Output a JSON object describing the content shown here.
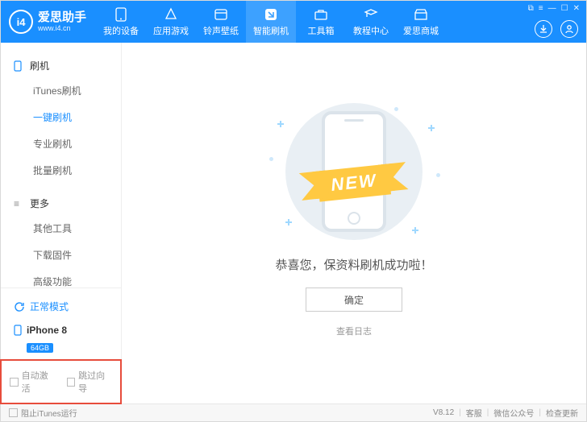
{
  "app": {
    "name": "爱思助手",
    "domain": "www.i4.cn",
    "logo_initials": "i4"
  },
  "nav": {
    "items": [
      {
        "label": "我的设备",
        "icon": "device-icon"
      },
      {
        "label": "应用游戏",
        "icon": "apps-icon"
      },
      {
        "label": "铃声壁纸",
        "icon": "ringtone-icon"
      },
      {
        "label": "智能刷机",
        "icon": "flash-icon"
      },
      {
        "label": "工具箱",
        "icon": "toolbox-icon"
      },
      {
        "label": "教程中心",
        "icon": "tutorial-icon"
      },
      {
        "label": "爱思商城",
        "icon": "store-icon"
      }
    ],
    "active_index": 3
  },
  "window_controls": [
    "⧉",
    "≡",
    "—",
    "☐",
    "✕"
  ],
  "sidebar": {
    "section_flash": "刷机",
    "section_more": "更多",
    "flash_items": [
      "iTunes刷机",
      "一键刷机",
      "专业刷机",
      "批量刷机"
    ],
    "flash_active_index": 1,
    "more_items": [
      "其他工具",
      "下载固件",
      "高级功能"
    ],
    "mode_label": "正常模式",
    "device_name": "iPhone 8",
    "device_capacity": "64GB",
    "check_auto_activate": "自动激活",
    "check_skip_wizard": "跳过向导"
  },
  "main": {
    "ribbon_text": "NEW",
    "success_message": "恭喜您，保资料刷机成功啦！",
    "ok_label": "确定",
    "view_log": "查看日志"
  },
  "footer": {
    "prevent_itunes": "阻止iTunes运行",
    "version": "V8.12",
    "support": "客服",
    "wechat": "微信公众号",
    "check_update": "检查更新"
  }
}
